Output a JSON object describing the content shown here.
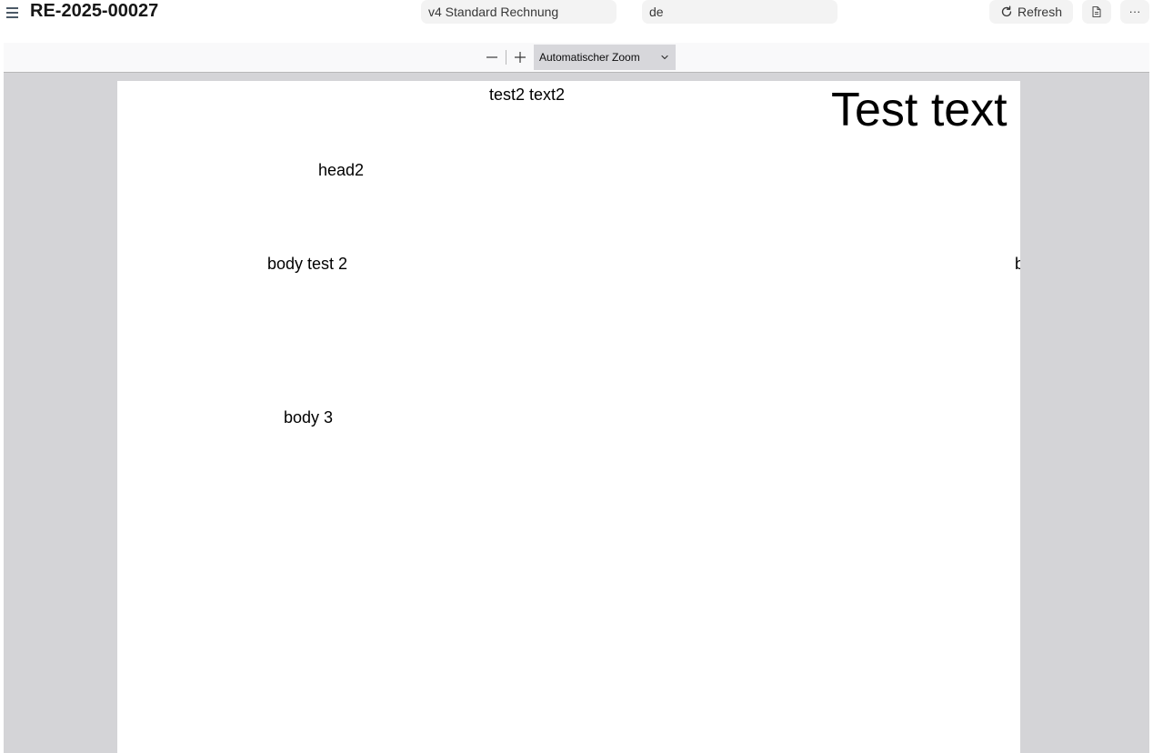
{
  "header": {
    "title": "RE-2025-00027",
    "template_select": "v4 Standard Rechnung",
    "language_select": "de",
    "refresh_label": "Refresh",
    "more_label": "···"
  },
  "viewer": {
    "zoom_label": "Automatischer Zoom",
    "page": {
      "texts": {
        "test2": "test2 text2",
        "big": "Test text",
        "head2": "head2",
        "body2": "body test 2",
        "clipped": "b",
        "body3": "body 3"
      }
    }
  },
  "icons": {
    "menu": "menu-icon",
    "refresh": "refresh-icon",
    "document": "document-icon",
    "more": "more-icon",
    "zoom_out": "minus-icon",
    "zoom_in": "plus-icon",
    "chevron": "chevron-down-icon"
  },
  "colors": {
    "viewer_background": "#d4d4d7",
    "button_background": "#f3f3f3"
  }
}
